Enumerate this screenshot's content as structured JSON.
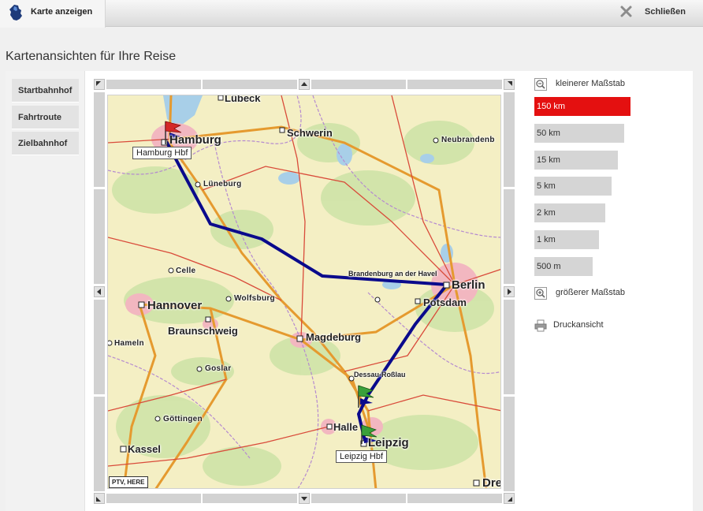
{
  "header": {
    "tab_label": "Karte anzeigen",
    "close_label": "Schließen"
  },
  "page_title": "Kartenansichten für Ihre Reise",
  "nav": [
    "Startbahnhof",
    "Fahrtroute",
    "Zielbahnhof"
  ],
  "map": {
    "places": {
      "luebeck": "Lübeck",
      "hamburg": "Hamburg",
      "schwerin": "Schwerin",
      "neubrandenburg": "Neubrandenb",
      "lueneburg": "Lüneburg",
      "celle": "Celle",
      "hannover": "Hannover",
      "wolfsburg": "Wolfsburg",
      "brandenburg": "Brandenburg an der Havel",
      "berlin": "Berlin",
      "potsdam": "Potsdam",
      "braunschweig": "Braunschweig",
      "magdeburg": "Magdeburg",
      "hameln": "Hameln",
      "goslar": "Goslar",
      "dessau": "Dessau-Roßlau",
      "goettingen": "Göttingen",
      "halle": "Halle",
      "leipzig": "Leipzig",
      "kassel": "Kassel",
      "dresden": "Dre"
    },
    "start_station": "Hamburg Hbf",
    "end_station": "Leipzig Hbf",
    "copyright": "PTV, HERE",
    "route_color": "#0a0a8c"
  },
  "scale": {
    "smaller_label": "kleinerer Maßstab",
    "larger_label": "größerer Maßstab",
    "options": [
      "150 km",
      "50 km",
      "15 km",
      "5 km",
      "2 km",
      "1 km",
      "500 m"
    ],
    "active": "150 km"
  },
  "print_label": "Druckansicht"
}
